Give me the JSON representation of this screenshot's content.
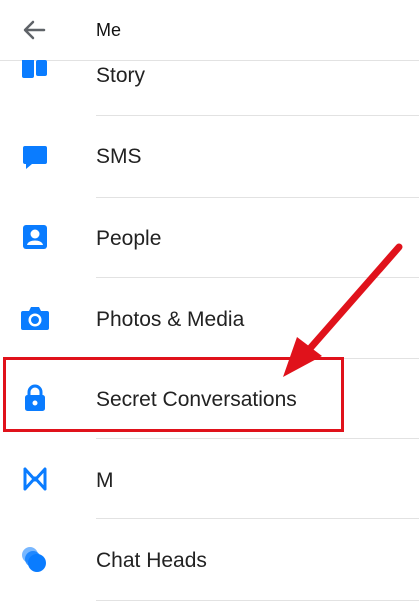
{
  "header": {
    "title": "Me",
    "back_icon": "arrow-left-icon"
  },
  "menu": {
    "items": [
      {
        "label": "Story",
        "icon": "story-icon"
      },
      {
        "label": "SMS",
        "icon": "chat-bubble-icon"
      },
      {
        "label": "People",
        "icon": "contact-card-icon"
      },
      {
        "label": "Photos & Media",
        "icon": "camera-icon"
      },
      {
        "label": "Secret Conversations",
        "icon": "lock-icon"
      },
      {
        "label": "M",
        "icon": "m-assistant-icon"
      },
      {
        "label": "Chat Heads",
        "icon": "chat-heads-icon"
      }
    ]
  },
  "colors": {
    "accent": "#0a7cff",
    "annotation": "#e0121b"
  }
}
